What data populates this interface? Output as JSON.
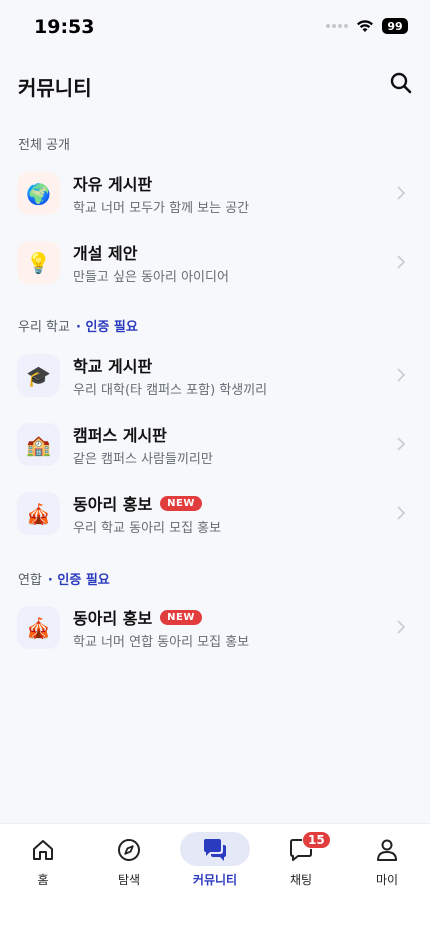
{
  "status_bar": {
    "time": "19:53",
    "battery": "99"
  },
  "header": {
    "title": "커뮤니티",
    "search_icon": "search-icon"
  },
  "sections": [
    {
      "title": "전체 공개",
      "requirement": ""
    },
    {
      "title": "우리 학교",
      "requirement": "· 인증 필요"
    },
    {
      "title": "연합",
      "requirement": "· 인증 필요"
    }
  ],
  "items": [
    {
      "icon": "🌍",
      "title": "자유 게시판",
      "subtitle": "학교 너머 모두가 함께 보는 공간",
      "badge": ""
    },
    {
      "icon": "💡",
      "title": "개설 제안",
      "subtitle": "만들고 싶은 동아리 아이디어",
      "badge": ""
    },
    {
      "icon": "🎓",
      "title": "학교 게시판",
      "subtitle": "우리 대학(타 캠퍼스 포함) 학생끼리",
      "badge": ""
    },
    {
      "icon": "🏫",
      "title": "캠퍼스 게시판",
      "subtitle": "같은 캠퍼스 사람들끼리만",
      "badge": ""
    },
    {
      "icon": "🎪",
      "title": "동아리 홍보",
      "subtitle": "우리 학교 동아리 모집 홍보",
      "badge": "NEW"
    },
    {
      "icon": "🎪",
      "title": "동아리 홍보",
      "subtitle": "학교 너머 연합 동아리 모집 홍보",
      "badge": "NEW"
    }
  ],
  "bottom_nav": {
    "items": [
      {
        "label": "홈",
        "icon": "home-icon"
      },
      {
        "label": "탐색",
        "icon": "compass-icon"
      },
      {
        "label": "커뮤니티",
        "icon": "chat-bubbles-icon",
        "active": true
      },
      {
        "label": "채팅",
        "icon": "chat-icon",
        "badge": "15"
      },
      {
        "label": "마이",
        "icon": "person-icon"
      }
    ]
  },
  "colors": {
    "accent": "#2b3bbf",
    "badge_red": "#e23d3d",
    "background": "#f7f8fb"
  }
}
